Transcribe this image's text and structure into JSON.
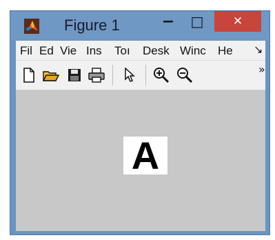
{
  "window": {
    "title": "Figure 1",
    "controls": {
      "minimize": "−",
      "maximize": "□",
      "close": "✕"
    },
    "colors": {
      "titlebar": "#6f98c4",
      "close": "#c9443c",
      "canvas": "#c8c8c8"
    }
  },
  "menubar": {
    "items": [
      "Fil",
      "Ed",
      "Vie",
      "Ins",
      "Toı",
      "Desk",
      "Winc",
      "He"
    ],
    "overflow": "↘"
  },
  "toolbar": {
    "icons": [
      "new-file-icon",
      "open-folder-icon",
      "save-icon",
      "print-icon",
      "pointer-icon",
      "zoom-in-icon",
      "zoom-out-icon"
    ],
    "overflow": "»"
  },
  "canvas": {
    "image_text": "A"
  }
}
